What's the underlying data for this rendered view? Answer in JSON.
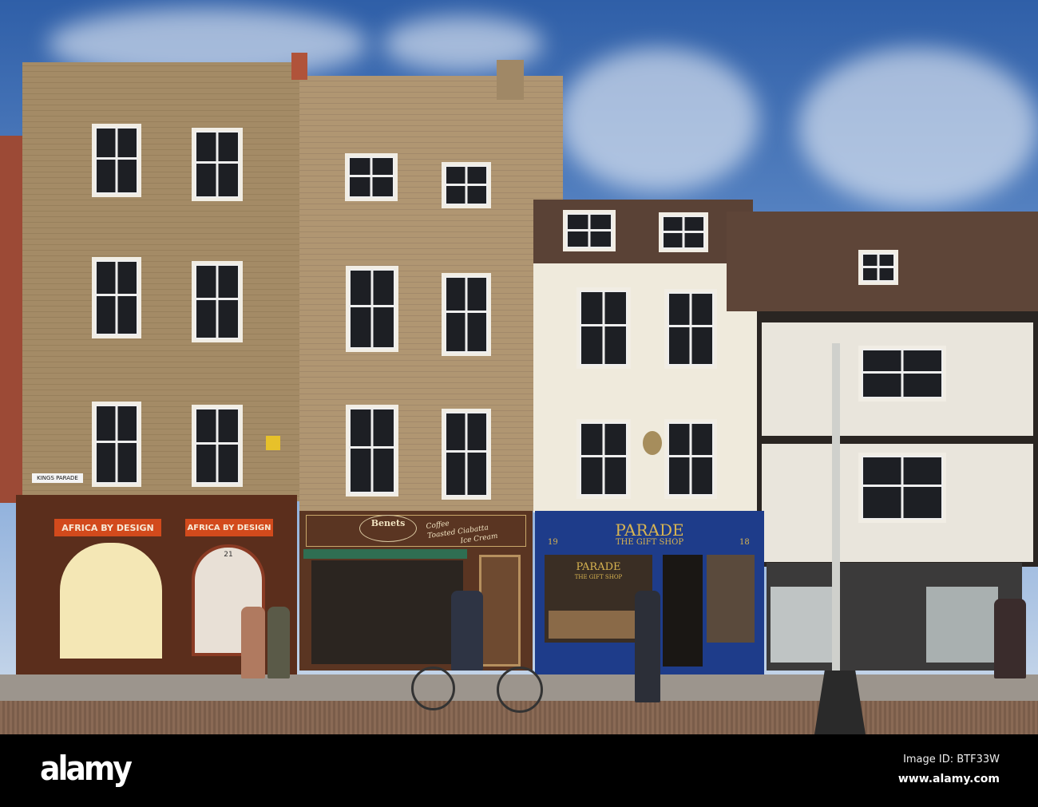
{
  "scene": {
    "street_sign": "KINGS PARADE",
    "shops": {
      "africa": {
        "name": "AFRICA BY DESIGN",
        "number": "21"
      },
      "benets": {
        "name": "Benets",
        "menu": [
          "Coffee",
          "Toasted Ciabatta",
          "Ice Cream"
        ]
      },
      "parade": {
        "name": "PARADE",
        "subtitle": "THE GIFT SHOP",
        "number_left": "19",
        "number_right": "18",
        "window_name": "PARADE",
        "window_subtitle": "THE GIFT SHOP"
      }
    }
  },
  "watermark": {
    "logo": "alamy",
    "image_id": "Image ID: BTF33W",
    "url": "www.alamy.com"
  }
}
